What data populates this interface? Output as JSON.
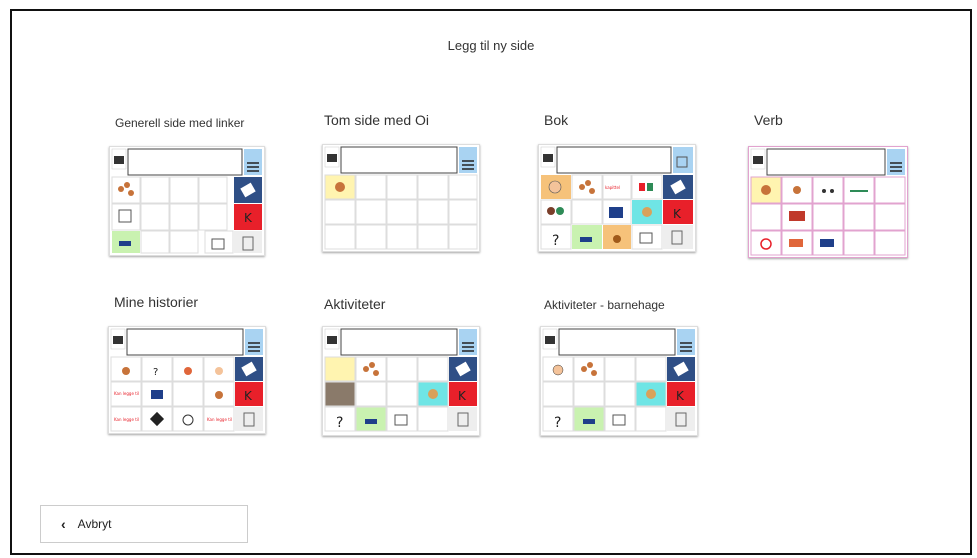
{
  "page": {
    "title": "Legg til ny side"
  },
  "templates": [
    {
      "name": "Generell side med linker",
      "small": true
    },
    {
      "name": "Tom side med Oi",
      "small": false
    },
    {
      "name": "Bok",
      "small": false
    },
    {
      "name": "Verb",
      "small": false
    },
    {
      "name": "Mine historier",
      "small": false
    },
    {
      "name": "Aktiviteter",
      "small": false
    },
    {
      "name": "Aktiviteter - barnehage",
      "small": true
    }
  ],
  "cancel": {
    "label": "Avbryt",
    "icon": "chevron-left-icon"
  },
  "colors": {
    "blue": "#2f4f86",
    "red": "#e8202a",
    "green": "#c9f2b0",
    "yellow": "#fff4b0",
    "lightblue": "#a9d3f2",
    "pink": "#e2a3cf"
  }
}
